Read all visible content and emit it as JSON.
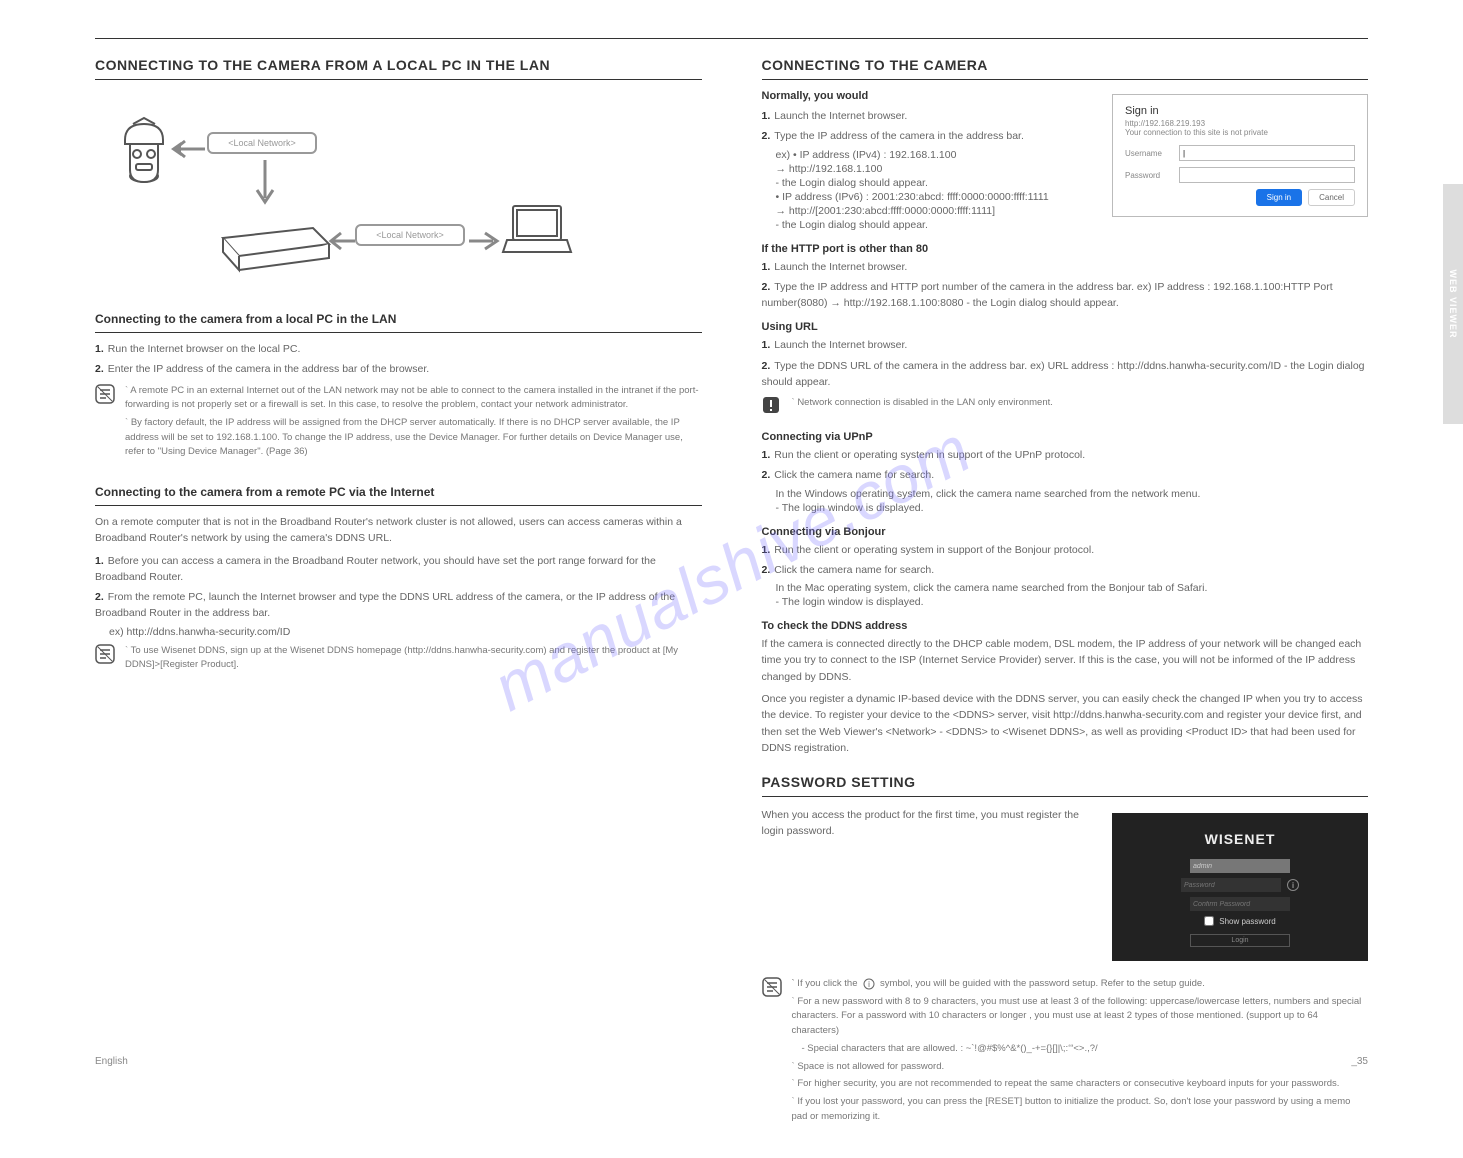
{
  "side_tab": "WEB VIEWER",
  "watermark": "manualshive.com",
  "page_lang": "English",
  "page_number": "_35",
  "left": {
    "title": "CONNECTING TO THE CAMERA FROM A LOCAL PC IN THE LAN",
    "diagram": {
      "ip_top": "<Local Network>",
      "ip_bottom": "<Local Network>",
      "cam_label": "",
      "pc_label": ""
    },
    "sub1_title": "Connecting to the camera from a local PC in the LAN",
    "sub1_steps": {
      "s1": "Run the Internet browser on the local PC.",
      "s2": "Enter the IP address of the camera in the address bar of the browser."
    },
    "note1": {
      "l1": "A remote PC in an external Internet out of the LAN network may not be able to connect to the camera installed in the intranet if the port-forwarding is not properly set or a firewall is set. In this case, to resolve the problem, contact your network administrator.",
      "l2": "By factory default, the IP address will be assigned from the DHCP server automatically. If there is no DHCP server available, the IP address will be set to 192.168.1.100. To change the IP address, use the Device Manager. For further details on Device Manager use, refer to \"Using Device Manager\". (Page 36)"
    },
    "sub2_title": "Connecting to the camera from a remote PC via the Internet",
    "sub2_intro": "On a remote computer that is not in the Broadband Router's network cluster is not allowed, users can access cameras within a Broadband Router's network by using the camera's DDNS URL.",
    "sub2_steps": {
      "s1": "Before you can access a camera in the Broadband Router network, you should have set the port range forward for the Broadband Router.",
      "s2": "From the remote PC, launch the Internet browser and type the DDNS URL address of the camera, or the IP address of the Broadband Router in the address bar."
    },
    "ex_label": "ex)",
    "ex_url": "http://ddns.hanwha-security.com/ID",
    "note2": "To use Wisenet DDNS, sign up at the Wisenet DDNS homepage (http://ddns.hanwha-security.com) and register the product at [My DDNS]>[Register Product]."
  },
  "right": {
    "title": "CONNECTING TO THE CAMERA",
    "normal_title": "Normally, you would",
    "normal_steps": {
      "s1": "Launch the Internet browser.",
      "s2a": "Type the IP address of the camera in the address bar.",
      "s2b": "ex) • IP address (IPv4) : 192.168.1.100",
      "s2c": "→ http://192.168.1.100",
      "s2d": "- the Login dialog should appear.",
      "s2e": "• IP address (IPv6) : 2001:230:abcd: ffff:0000:0000:ffff:1111",
      "s2f": "→ http://[2001:230:abcd:ffff:0000:0000:ffff:1111]",
      "s2g": "- the Login dialog should appear."
    },
    "signin": {
      "title": "Sign in",
      "url": "http://192.168.219.193",
      "priv": "Your connection to this site is not private",
      "label_user": "Username",
      "label_pass": "Password",
      "btn_signin": "Sign in",
      "btn_cancel": "Cancel"
    },
    "http_title": "If the HTTP port is other than 80",
    "http_s1": "Launch the Internet browser.",
    "http_s2": "Type the IP address and HTTP port number of the camera in the address bar. ex) IP address : 192.168.1.100:HTTP Port number(8080) → http://192.168.1.100:8080 - the Login dialog should appear.",
    "url_title": "Using URL",
    "url_s1": "Launch the Internet browser.",
    "url_s2": "Type the DDNS URL of the camera in the address bar. ex) URL address : http://ddns.hanwha-security.com/ID - the Login dialog should appear.",
    "warn1": "Network connection is disabled in the LAN only environment.",
    "upnp_title": "Connecting via UPnP",
    "upnp_s1": "Run the client or operating system in support of the UPnP protocol.",
    "upnp_s2": "Click the camera name for search.",
    "upnp_s2b": "In the Windows operating system, click the camera name searched from the network menu.",
    "upnp_s2c": "- The login window is displayed.",
    "bonjour_title": "Connecting via Bonjour",
    "bonjour_s1": "Run the client or operating system in support of the Bonjour protocol.",
    "bonjour_s2": "Click the camera name for search.",
    "bonjour_s2b": "In the Mac operating system, click the camera name searched from the Bonjour tab of Safari.",
    "bonjour_s2c": "- The login window is displayed.",
    "check_title": "To check the DDNS address",
    "check_text1": "If the camera is connected directly to the DHCP cable modem, DSL modem, the IP address of your network will be changed each time you try to connect to the ISP (Internet Service Provider) server. If this is the case, you will not be informed of the IP address changed by DDNS.",
    "check_text2": "Once you register a dynamic IP-based device with the DDNS server, you can easily check the changed IP when you try to access the device. To register your device to the <DDNS> server, visit http://ddns.hanwha-security.com and register your device first, and then set the Web Viewer's <Network> - <DDNS> to <Wisenet DDNS>, as well as providing <Product ID> that had been used for DDNS registration.",
    "pw_title": "PASSWORD SETTING",
    "pw_intro": "When you access the product for the first time, you must register the login password.",
    "wisenet": {
      "logo": "WISENET",
      "admin": "admin",
      "password_ph": "Password",
      "confirm_ph": "Confirm Password",
      "show": "Show password",
      "login": "Login"
    },
    "pw_note": {
      "l1": "For a new password with 8 to 9 characters, you must use at least 3 of the following: uppercase/lowercase letters, numbers and special characters. For a password with 10 characters or longer , you must use at least 2 types of those mentioned. (support up to 64 characters)",
      "l2": "- Special characters that are allowed. : ~`!@#$%^&*()_-+={}[]|\\;:‘“<>.,?/",
      "l3": "Space is not allowed for password.",
      "l4": "For higher security, you are not recommended to repeat the same characters or consecutive keyboard inputs for your passwords.",
      "l5": "If you lost your password, you can press the [RESET] button to initialize the product. So, don't lose your password by using a memo pad or memorizing it."
    }
  }
}
